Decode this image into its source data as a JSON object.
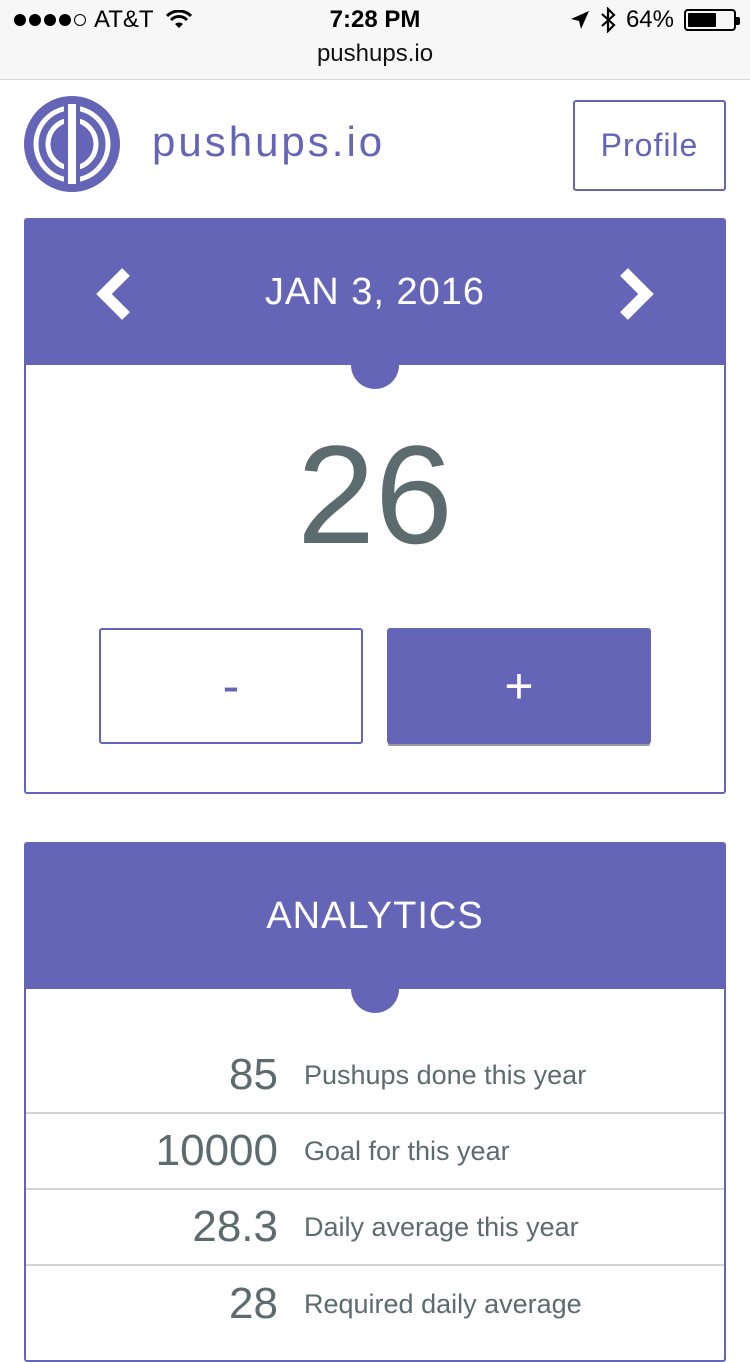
{
  "status_bar": {
    "carrier": "AT&T",
    "time": "7:28 PM",
    "battery": "64%",
    "battery_level": 0.64,
    "url": "pushups.io"
  },
  "header": {
    "brand": "pushups.io",
    "profile_label": "Profile"
  },
  "counter_card": {
    "date": "JAN 3, 2016",
    "count": "26",
    "minus_label": "-",
    "plus_label": "+"
  },
  "analytics": {
    "title": "ANALYTICS",
    "rows": [
      {
        "value": "85",
        "label": "Pushups done this year"
      },
      {
        "value": "10000",
        "label": "Goal for this year"
      },
      {
        "value": "28.3",
        "label": "Daily average this year"
      },
      {
        "value": "28",
        "label": "Required daily average"
      }
    ]
  },
  "colors": {
    "accent": "#6565b8",
    "text": "#5c6b6d"
  }
}
